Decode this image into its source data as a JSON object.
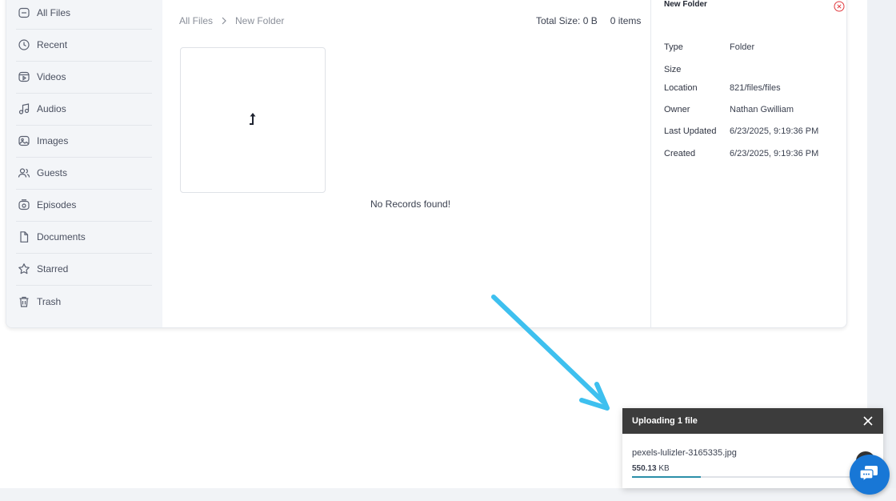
{
  "sidebar": {
    "items": [
      {
        "label": "All Files",
        "icon": "folder-icon"
      },
      {
        "label": "Recent",
        "icon": "clock-icon"
      },
      {
        "label": "Videos",
        "icon": "video-icon"
      },
      {
        "label": "Audios",
        "icon": "music-icon"
      },
      {
        "label": "Images",
        "icon": "image-icon"
      },
      {
        "label": "Guests",
        "icon": "users-icon"
      },
      {
        "label": "Episodes",
        "icon": "episode-icon"
      },
      {
        "label": "Documents",
        "icon": "document-icon"
      },
      {
        "label": "Starred",
        "icon": "star-icon"
      },
      {
        "label": "Trash",
        "icon": "trash-icon"
      }
    ]
  },
  "breadcrumb": {
    "root": "All Files",
    "current": "New Folder"
  },
  "summary": {
    "total_size": "Total Size: 0 B",
    "items": "0 items"
  },
  "content": {
    "empty_message": "No Records found!",
    "tile_icon": "up-arrow-icon"
  },
  "details": {
    "title": "New Folder",
    "rows": [
      {
        "key": "Type",
        "value": "Folder"
      },
      {
        "key": "Size",
        "value": ""
      },
      {
        "key": "Location",
        "value": "821/files/files"
      },
      {
        "key": "Owner",
        "value": "Nathan Gwilliam"
      },
      {
        "key": "Last Updated",
        "value": "6/23/2025, 9:19:36 PM"
      },
      {
        "key": "Created",
        "value": "6/23/2025, 9:19:36 PM"
      }
    ]
  },
  "upload": {
    "title": "Uploading 1 file",
    "file_name": "pexels-lulizler-3165335.jpg",
    "file_size_value": "550.13",
    "file_size_unit": "KB",
    "progress_fraction": 0.3
  },
  "colors": {
    "accent": "#2b8fa8",
    "arrow": "#3ec0ef",
    "chat": "#1877d6",
    "upload_header": "#3c3c3c",
    "close_red": "#e0393e"
  }
}
